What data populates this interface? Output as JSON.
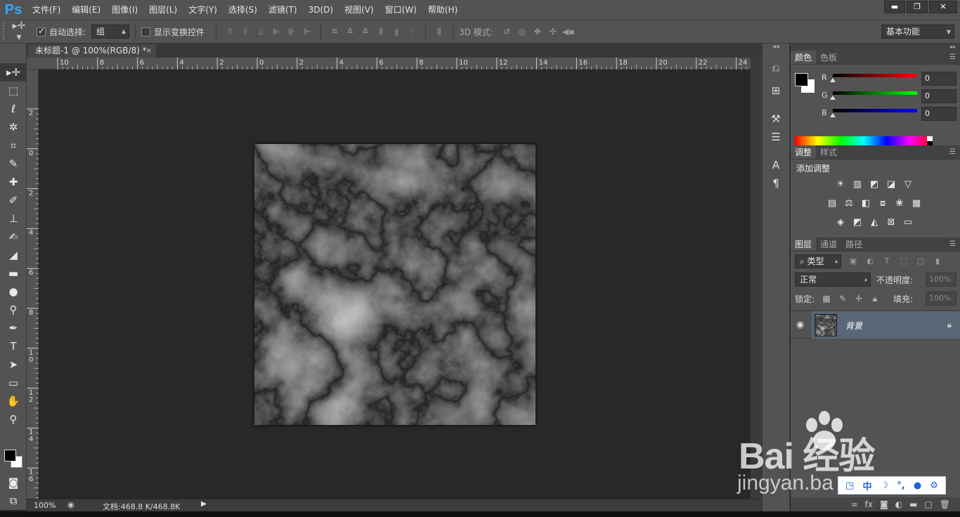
{
  "app": {
    "logo": "Ps"
  },
  "menu": [
    "文件(F)",
    "编辑(E)",
    "图像(I)",
    "图层(L)",
    "文字(Y)",
    "选择(S)",
    "滤镜(T)",
    "3D(D)",
    "视图(V)",
    "窗口(W)",
    "帮助(H)"
  ],
  "window_controls": {
    "minimize": "▬",
    "restore": "❐",
    "close": "✕"
  },
  "options": {
    "auto_select_label": "自动选择:",
    "auto_select_value": "组",
    "show_transform_label": "显示变换控件",
    "mode_3d_label": "3D 模式:",
    "workspace": "基本功能"
  },
  "document": {
    "tab_title": "未标题-1 @ 100%(RGB/8) *",
    "close": "×"
  },
  "ruler": {
    "h_ticks": [
      "10",
      "8",
      "6",
      "4",
      "2",
      "0",
      "2",
      "4",
      "6",
      "8",
      "10",
      "12",
      "14",
      "16",
      "18",
      "20",
      "22",
      "24"
    ],
    "v_ticks": [
      "2",
      "0",
      "2",
      "4",
      "6",
      "8",
      "1 0",
      "1 2",
      "1 4",
      "1 6"
    ]
  },
  "status": {
    "zoom": "100%",
    "doc_size": "文档:468.8 K/468.8K",
    "arrow": "▶"
  },
  "color_panel": {
    "tabs": [
      "颜色",
      "色板"
    ],
    "rows": [
      {
        "label": "R",
        "value": "0",
        "color": "#ff0000"
      },
      {
        "label": "G",
        "value": "0",
        "color": "#00ff00"
      },
      {
        "label": "B",
        "value": "0",
        "color": "#0000ff"
      }
    ]
  },
  "adjust_panel": {
    "tabs": [
      "调整",
      "样式"
    ],
    "title": "添加调整"
  },
  "layers_panel": {
    "tabs": [
      "图层",
      "通道",
      "路径"
    ],
    "filter_label": "类型",
    "blend_mode": "正常",
    "opacity_label": "不透明度:",
    "opacity_value": "100%",
    "lock_label": "锁定:",
    "fill_label": "填充:",
    "fill_value": "100%",
    "layer_name": "背景"
  },
  "watermark": {
    "brand": "Bai   经验",
    "url": "jingyan.ba",
    "ime": [
      "中"
    ]
  }
}
